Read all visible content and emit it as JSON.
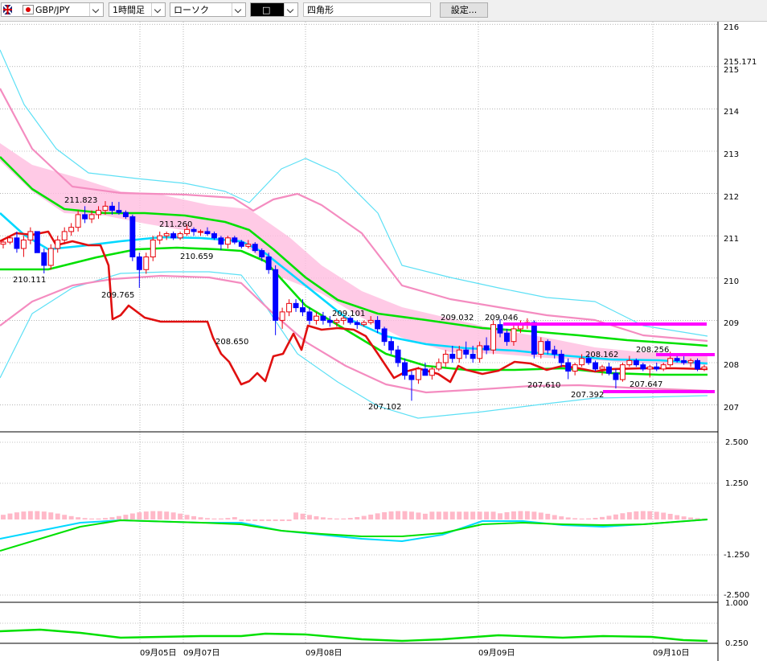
{
  "toolbar": {
    "pair": "GBP/JPY",
    "timeframe": "1時間足",
    "chart_type": "ローソク",
    "draw_tool_mark": "□",
    "draw_tool_name": "四角形",
    "settings_label": "設定..."
  },
  "colors": {
    "bull": "#e8000a",
    "bear": "#0000ff",
    "grid": "#888888",
    "bollinger_outer": "#5de0f5",
    "bollinger_inner": "#f48cc0",
    "ma_green": "#00e000",
    "ma_cyan": "#00d8ff",
    "cloud": "#ffbde0",
    "red_line": "#e01010",
    "rect_magenta": "#ff00ff"
  },
  "chart_data": [
    {
      "type": "candlestick",
      "panel": "main",
      "ylim": [
        206.5,
        216.2
      ],
      "y_ticks": [
        "216",
        "215",
        "214",
        "213",
        "212",
        "211",
        "210",
        "209",
        "208",
        "207"
      ],
      "current_price_label": "215.171",
      "x_labels": [
        "09月05日",
        "09月07日",
        "09月08日",
        "09月09日",
        "09月10日"
      ],
      "price_annotations": [
        "211.823",
        "211.260",
        "210.659",
        "210.111",
        "209.765",
        "208.650",
        "209.101",
        "207.102",
        "209.032",
        "209.046",
        "207.610",
        "208.162",
        "207.392",
        "208.256",
        "207.647"
      ],
      "candles": [
        [
          210.8,
          210.9,
          210.7,
          210.85
        ],
        [
          210.85,
          211.0,
          210.8,
          210.95
        ],
        [
          210.95,
          211.1,
          210.6,
          210.7
        ],
        [
          210.7,
          211.0,
          210.5,
          210.9
        ],
        [
          210.9,
          211.2,
          210.8,
          211.1
        ],
        [
          211.1,
          211.1,
          210.6,
          210.6
        ],
        [
          210.6,
          210.7,
          210.11,
          210.3
        ],
        [
          210.3,
          210.8,
          210.2,
          210.7
        ],
        [
          210.7,
          211.0,
          210.6,
          210.9
        ],
        [
          210.9,
          211.2,
          210.8,
          211.1
        ],
        [
          211.1,
          211.3,
          211.0,
          211.2
        ],
        [
          211.2,
          211.6,
          211.1,
          211.5
        ],
        [
          211.5,
          211.7,
          211.3,
          211.4
        ],
        [
          211.4,
          211.6,
          211.3,
          211.5
        ],
        [
          211.5,
          211.7,
          211.4,
          211.6
        ],
        [
          211.6,
          211.82,
          211.5,
          211.7
        ],
        [
          211.7,
          211.8,
          211.5,
          211.6
        ],
        [
          211.6,
          211.8,
          211.5,
          211.55
        ],
        [
          211.55,
          211.6,
          211.4,
          211.45
        ],
        [
          211.45,
          211.5,
          210.4,
          210.5
        ],
        [
          210.5,
          210.6,
          209.77,
          210.2
        ],
        [
          210.2,
          210.6,
          210.1,
          210.5
        ],
        [
          210.5,
          211.0,
          210.4,
          210.9
        ],
        [
          210.9,
          211.1,
          210.8,
          211.0
        ],
        [
          211.0,
          211.1,
          210.9,
          211.05
        ],
        [
          211.05,
          211.1,
          210.9,
          210.95
        ],
        [
          210.95,
          211.1,
          210.9,
          211.05
        ],
        [
          211.05,
          211.26,
          211.0,
          211.15
        ],
        [
          211.15,
          211.2,
          211.0,
          211.1
        ],
        [
          211.1,
          211.15,
          211.0,
          211.1
        ],
        [
          211.1,
          211.2,
          211.0,
          211.05
        ],
        [
          211.05,
          211.1,
          210.9,
          210.95
        ],
        [
          210.95,
          211.0,
          210.66,
          210.8
        ],
        [
          210.8,
          211.0,
          210.7,
          210.95
        ],
        [
          210.95,
          211.0,
          210.8,
          210.85
        ],
        [
          210.85,
          210.9,
          210.7,
          210.75
        ],
        [
          210.75,
          210.9,
          210.7,
          210.8
        ],
        [
          210.8,
          210.85,
          210.6,
          210.65
        ],
        [
          210.65,
          210.7,
          210.4,
          210.5
        ],
        [
          210.5,
          210.6,
          210.1,
          210.2
        ],
        [
          210.2,
          210.3,
          208.65,
          209.0
        ],
        [
          209.0,
          209.3,
          208.8,
          209.2
        ],
        [
          209.2,
          209.5,
          209.1,
          209.4
        ],
        [
          209.4,
          209.5,
          209.2,
          209.3
        ],
        [
          209.3,
          209.5,
          209.1,
          209.2
        ],
        [
          209.2,
          209.3,
          208.9,
          209.0
        ],
        [
          209.0,
          209.2,
          208.9,
          209.1
        ],
        [
          209.1,
          209.2,
          208.9,
          209.0
        ],
        [
          209.0,
          209.1,
          208.85,
          208.95
        ],
        [
          208.95,
          209.05,
          208.85,
          209.0
        ],
        [
          209.0,
          209.1,
          208.9,
          209.05
        ],
        [
          209.05,
          209.1,
          208.9,
          208.95
        ],
        [
          208.95,
          209.0,
          208.8,
          208.9
        ],
        [
          208.9,
          209.0,
          208.85,
          208.95
        ],
        [
          208.95,
          209.1,
          208.9,
          209.0
        ],
        [
          209.0,
          209.1,
          208.7,
          208.8
        ],
        [
          208.8,
          208.85,
          208.4,
          208.5
        ],
        [
          208.5,
          208.6,
          208.2,
          208.3
        ],
        [
          208.3,
          208.4,
          207.9,
          208.0
        ],
        [
          208.0,
          208.1,
          207.6,
          207.7
        ],
        [
          207.7,
          207.8,
          207.1,
          207.6
        ],
        [
          207.6,
          207.9,
          207.5,
          207.85
        ],
        [
          207.85,
          208.0,
          207.7,
          207.7
        ],
        [
          207.7,
          207.9,
          207.6,
          207.85
        ],
        [
          207.85,
          208.1,
          207.8,
          208.0
        ],
        [
          208.0,
          208.3,
          207.9,
          208.2
        ],
        [
          208.2,
          208.4,
          208.0,
          208.1
        ],
        [
          208.1,
          208.4,
          208.0,
          208.3
        ],
        [
          208.3,
          208.5,
          208.1,
          208.2
        ],
        [
          208.2,
          208.4,
          208.0,
          208.1
        ],
        [
          208.1,
          208.5,
          208.0,
          208.4
        ],
        [
          208.4,
          208.6,
          208.2,
          208.3
        ],
        [
          208.3,
          209.0,
          208.2,
          208.9
        ],
        [
          208.9,
          209.03,
          208.6,
          208.7
        ],
        [
          208.7,
          208.8,
          208.4,
          208.5
        ],
        [
          208.5,
          208.9,
          208.4,
          208.8
        ],
        [
          208.8,
          209.0,
          208.7,
          208.9
        ],
        [
          208.9,
          209.05,
          208.8,
          208.95
        ],
        [
          208.95,
          209.0,
          208.1,
          208.2
        ],
        [
          208.2,
          208.6,
          208.1,
          208.5
        ],
        [
          208.5,
          208.55,
          208.2,
          208.3
        ],
        [
          208.3,
          208.4,
          208.1,
          208.2
        ],
        [
          208.2,
          208.3,
          207.9,
          208.0
        ],
        [
          208.0,
          208.1,
          207.61,
          207.8
        ],
        [
          207.8,
          208.0,
          207.7,
          207.95
        ],
        [
          207.95,
          208.2,
          207.9,
          208.1
        ],
        [
          208.1,
          208.2,
          207.95,
          208.0
        ],
        [
          208.0,
          208.05,
          207.8,
          207.85
        ],
        [
          207.85,
          207.95,
          207.7,
          207.9
        ],
        [
          207.9,
          208.0,
          207.7,
          207.75
        ],
        [
          207.75,
          207.85,
          207.39,
          207.6
        ],
        [
          207.6,
          208.0,
          207.55,
          207.95
        ],
        [
          207.95,
          208.16,
          207.9,
          208.05
        ],
        [
          208.05,
          208.1,
          207.9,
          207.95
        ],
        [
          207.95,
          208.0,
          207.8,
          207.85
        ],
        [
          207.85,
          207.95,
          207.65,
          207.9
        ],
        [
          207.9,
          208.0,
          207.8,
          207.85
        ],
        [
          207.85,
          208.0,
          207.8,
          207.95
        ],
        [
          207.95,
          208.26,
          207.9,
          208.1
        ],
        [
          208.1,
          208.2,
          208.0,
          208.05
        ],
        [
          208.05,
          208.15,
          207.95,
          208.0
        ],
        [
          208.0,
          208.1,
          207.9,
          208.05
        ],
        [
          208.05,
          208.1,
          207.8,
          207.85
        ],
        [
          207.85,
          207.95,
          207.8,
          207.9
        ]
      ]
    },
    {
      "type": "line",
      "panel": "macd",
      "ylim": [
        -3.0,
        3.0
      ],
      "y_ticks": [
        "2.500",
        "1.250",
        "-1.250",
        "-2.500"
      ]
    },
    {
      "type": "line",
      "panel": "oscillator",
      "ylim": [
        0.0,
        1.1
      ],
      "y_ticks": [
        "1.000",
        "0.250"
      ]
    }
  ]
}
